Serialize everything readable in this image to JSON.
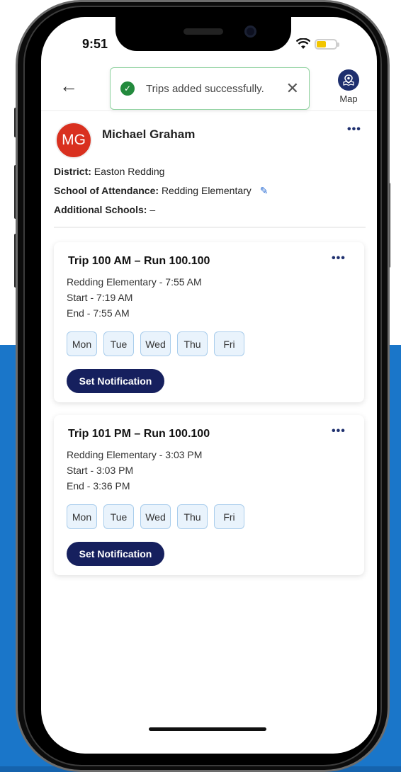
{
  "status": {
    "time": "9:51"
  },
  "toast": {
    "message": "Trips  added successfully.",
    "close": "✕"
  },
  "header": {
    "back": "←",
    "map_label": "Map"
  },
  "profile": {
    "initials": "MG",
    "name": "Michael Graham",
    "more": "•••",
    "district_label": "District:",
    "district": "Easton Redding",
    "school_label": "School of Attendance:",
    "school": "Redding Elementary",
    "additional_label": "Additional Schools:",
    "additional": "–"
  },
  "trips": [
    {
      "title": "Trip 100 AM – Run 100.100",
      "school_time": "Redding Elementary - 7:55 AM",
      "start": "Start - 7:19 AM",
      "end": "End - 7:55 AM",
      "days": [
        "Mon",
        "Tue",
        "Wed",
        "Thu",
        "Fri"
      ],
      "button": "Set Notification",
      "more": "•••"
    },
    {
      "title": "Trip 101 PM – Run 100.100",
      "school_time": "Redding Elementary - 3:03 PM",
      "start": "Start - 3:03 PM",
      "end": "End - 3:36 PM",
      "days": [
        "Mon",
        "Tue",
        "Wed",
        "Thu",
        "Fri"
      ],
      "button": "Set Notification",
      "more": "•••"
    }
  ],
  "colors": {
    "background_blue": "#1a76c9",
    "navy": "#16205e",
    "avatar_red": "#d9301f",
    "success_green": "#238a3d",
    "day_chip_bg": "#e9f3fc"
  }
}
